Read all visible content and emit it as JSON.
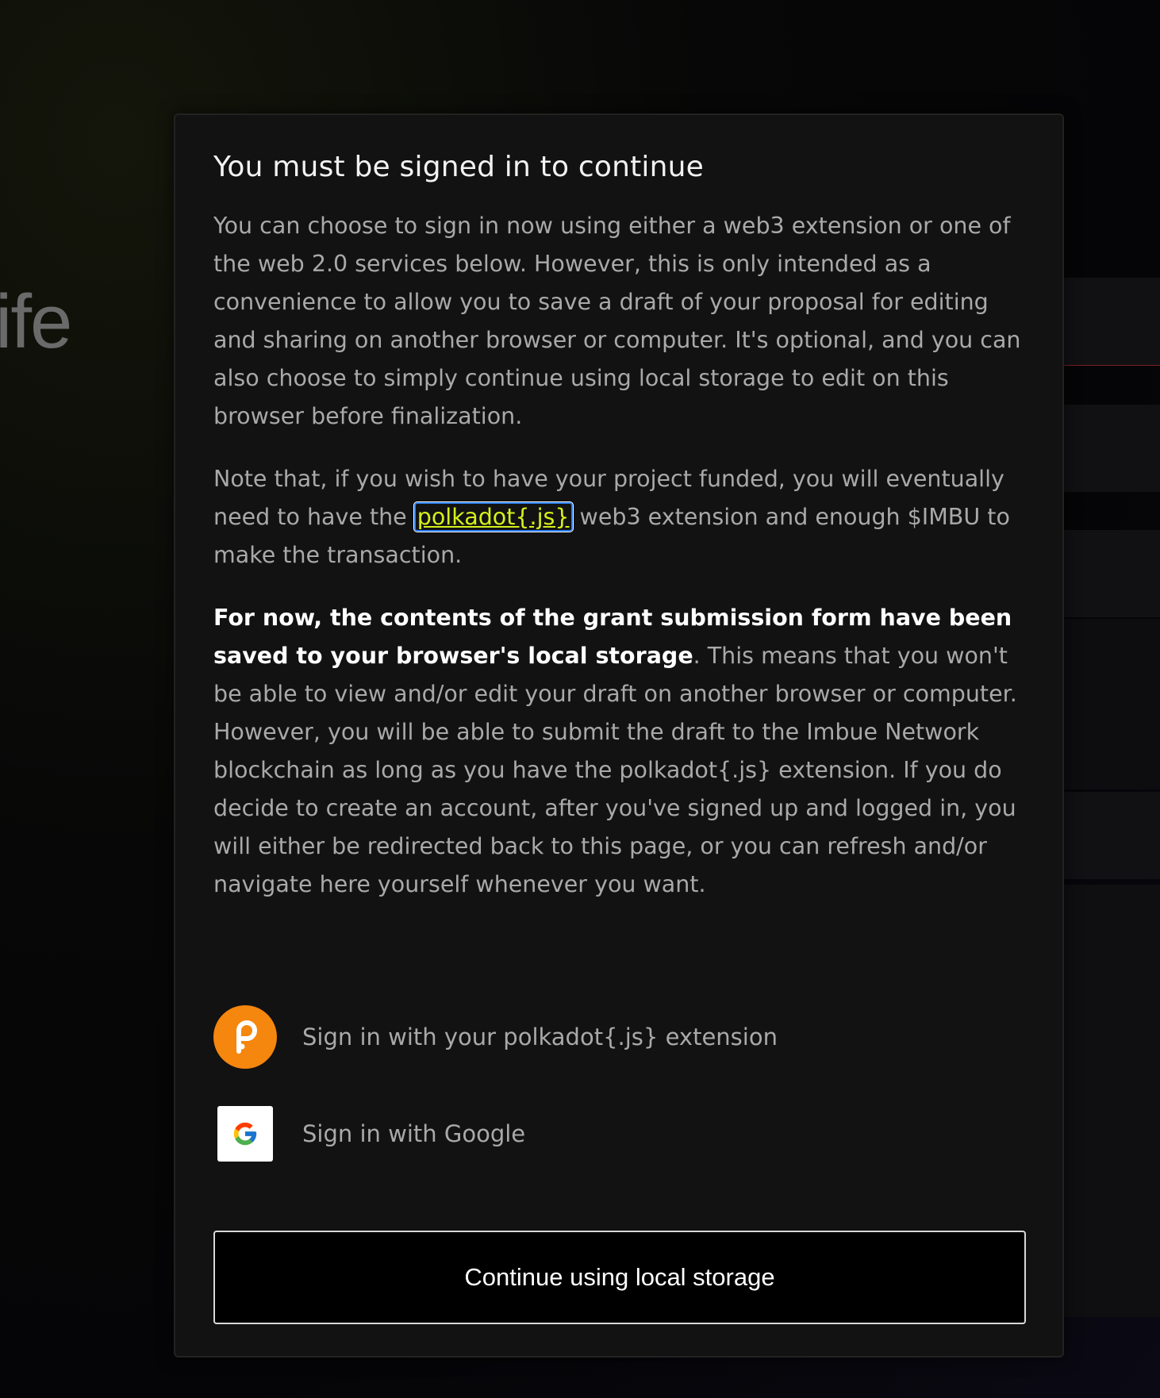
{
  "background": {
    "word": "ife"
  },
  "modal": {
    "title": "You must be signed in to continue",
    "para1": "You can choose to sign in now using either a web3 extension or one of the web 2.0 services below. However, this is only intended as a convenience to allow you to save a draft of your proposal for editing and sharing on another browser or computer. It's optional, and you can also choose to simply continue using local storage to edit on this browser before finalization.",
    "para2": {
      "before": "Note that, if you wish to have your project funded, you will eventually need to have the ",
      "link": "polkadot{.js}",
      "after": " web3 extension and enough $IMBU to make the transaction."
    },
    "para3": {
      "bold": "For now, the contents of the grant submission form have been saved to your browser's local storage",
      "rest": ". This means that you won't be able to view and/or edit your draft on another browser or computer. However, you will be able to submit the draft to the Imbue Network blockchain as long as you have the polkadot{.js} extension. If you do decide to create an account, after you've signed up and logged in, you will either be redirected back to this page, or you can refresh and/or navigate here yourself whenever you want."
    },
    "signin_options": [
      {
        "label": "Sign in with your polkadot{.js} extension",
        "icon": "polkadot-icon"
      },
      {
        "label": "Sign in with Google",
        "icon": "google-icon"
      }
    ],
    "continue_label": "Continue using local storage"
  },
  "colors": {
    "link": "#d6f01a",
    "polkadot": "#f5860e",
    "modal_bg": "#121212"
  }
}
